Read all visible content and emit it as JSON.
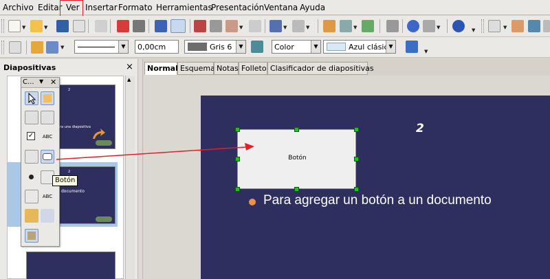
{
  "menubar": {
    "items": [
      {
        "label": "Archivo"
      },
      {
        "label": "Editar"
      },
      {
        "label": "Ver"
      },
      {
        "label": "Insertar"
      },
      {
        "label": "Formato"
      },
      {
        "label": "Herramientas"
      },
      {
        "label": "Presentación"
      },
      {
        "label": "Ventana"
      },
      {
        "label": "Ayuda"
      }
    ]
  },
  "line_toolbar": {
    "line_width": "0,00cm",
    "line_color": "Gris 6",
    "area_style": "Color",
    "area_color": "Azul clásico"
  },
  "slides_panel": {
    "title": "Diapositivas",
    "close": "×"
  },
  "view_tabs": [
    {
      "label": "Normal"
    },
    {
      "label": "Esquema"
    },
    {
      "label": "Notas"
    },
    {
      "label": "Folleto"
    },
    {
      "label": "Clasificador de diapositivas"
    }
  ],
  "form_toolbar": {
    "title": "C...",
    "tooltip": "Botón",
    "text_tool_label": "ABC"
  },
  "slide": {
    "number": "2",
    "button_label": "Botón",
    "bullet_text": "Para agregar un botón a un documento"
  },
  "thumbnails": {
    "thumb1_text": "ra una diapositiva",
    "thumb2_text": "documento",
    "num": "2"
  },
  "colors": {
    "slide_bg": "#2e2f5f",
    "handle": "#20c020",
    "arrow": "#e0202a",
    "bullet": "#f0904a"
  }
}
